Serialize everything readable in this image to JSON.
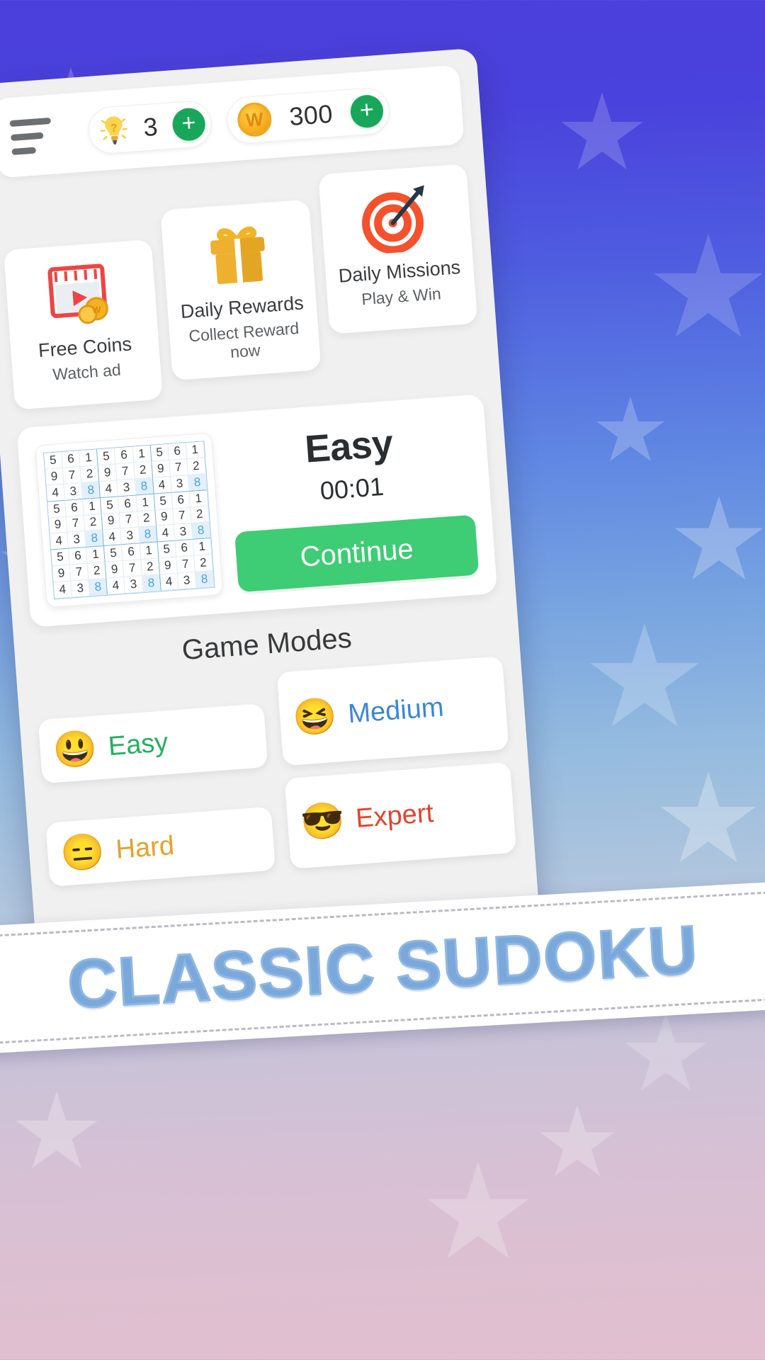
{
  "background": {
    "gradient_top": "#4b3fdb",
    "gradient_bottom": "#e2bfcf"
  },
  "topbar": {
    "menu_icon": "hamburger-icon",
    "hint": {
      "icon": "lightbulb-icon",
      "value": "3",
      "add_label": "+"
    },
    "coins": {
      "icon": "coin-icon",
      "coin_glyph": "W",
      "value": "300",
      "add_label": "+"
    }
  },
  "feature_cards": [
    {
      "icon": "video-ad-coins-icon",
      "title": "Free Coins",
      "subtitle": "Watch ad"
    },
    {
      "icon": "gift-box-icon",
      "title": "Daily Rewards",
      "subtitle": "Collect Reward now"
    },
    {
      "icon": "dartboard-target-icon",
      "title": "Daily Missions",
      "subtitle": "Play & Win"
    }
  ],
  "continue_card": {
    "level": "Easy",
    "time": "00:01",
    "button_label": "Continue",
    "button_color": "#3ecc74",
    "board_rows": [
      [
        "5",
        "6",
        "1",
        "5",
        "6",
        "1",
        "5",
        "6",
        "1"
      ],
      [
        "9",
        "7",
        "2",
        "9",
        "7",
        "2",
        "9",
        "7",
        "2"
      ],
      [
        "4",
        "3",
        "8",
        "4",
        "3",
        "8",
        "4",
        "3",
        "8"
      ],
      [
        "5",
        "6",
        "1",
        "5",
        "6",
        "1",
        "5",
        "6",
        "1"
      ],
      [
        "9",
        "7",
        "2",
        "9",
        "7",
        "2",
        "9",
        "7",
        "2"
      ],
      [
        "4",
        "3",
        "8",
        "4",
        "3",
        "8",
        "4",
        "3",
        "8"
      ],
      [
        "5",
        "6",
        "1",
        "5",
        "6",
        "1",
        "5",
        "6",
        "1"
      ],
      [
        "9",
        "7",
        "2",
        "9",
        "7",
        "2",
        "9",
        "7",
        "2"
      ],
      [
        "4",
        "3",
        "8",
        "4",
        "3",
        "8",
        "4",
        "3",
        "8"
      ]
    ],
    "highlight_value": "8",
    "highlight_color": "#4aa3e0"
  },
  "game_modes": {
    "heading": "Game Modes",
    "items": [
      {
        "emoji": "grinning-face-emoji",
        "glyph": "😃",
        "label": "Easy",
        "color": "#27ae60"
      },
      {
        "emoji": "squinting-face-emoji",
        "glyph": "😆",
        "label": "Medium",
        "color": "#3b86d8"
      },
      {
        "emoji": "expressionless-face-emoji",
        "glyph": "😑",
        "label": "Hard",
        "color": "#e2a32b"
      },
      {
        "emoji": "sunglasses-face-emoji",
        "glyph": "😎",
        "label": "Expert",
        "color": "#e0452c"
      }
    ]
  },
  "banner": {
    "text": "CLASSIC SUDOKU",
    "color": "#7aa8da"
  }
}
